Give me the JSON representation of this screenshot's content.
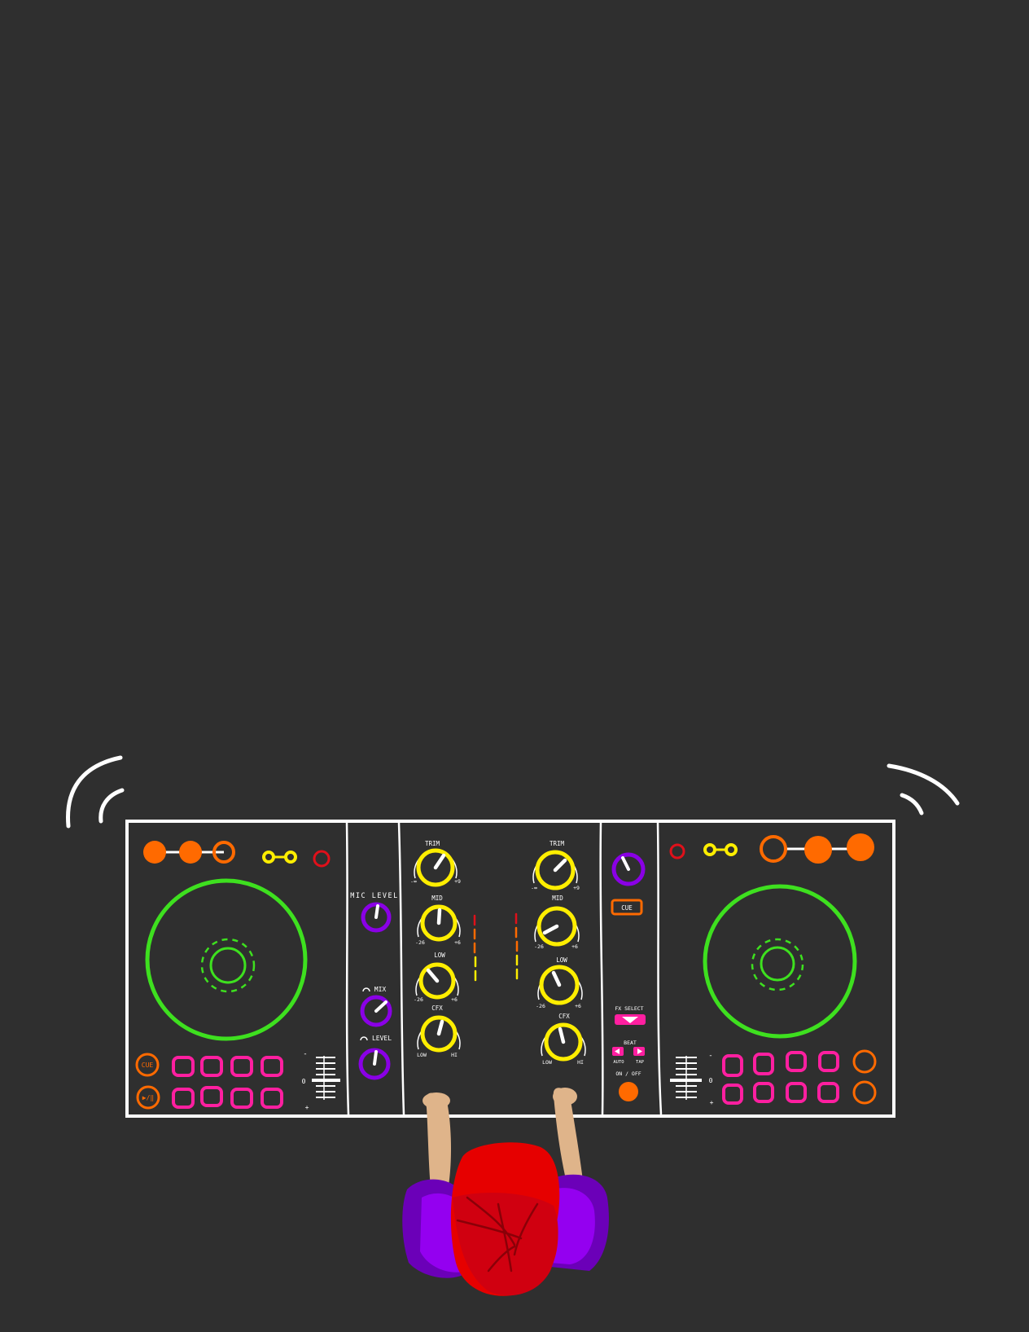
{
  "colors": {
    "background": "#2f2f2f",
    "outline": "#ffffff",
    "jog_wheel": "#3ee01f",
    "knob_eq": "#ffee00",
    "knob_purple": "#8a00e6",
    "pads": "#ff1fa0",
    "orange": "#ff6a00",
    "red": "#e0101a",
    "skin": "#dfb48a",
    "cap": "#e60000",
    "shirt": "#9400f0"
  },
  "mic_section": {
    "mic_level_label": "MIC LEVEL",
    "mix_label": "MIX",
    "level_label": "LEVEL"
  },
  "channel_1": {
    "trim_label": "TRIM",
    "trim_min": "-∞",
    "trim_max": "+9",
    "mid_label": "MID",
    "mid_min": "-26",
    "mid_max": "+6",
    "low_label": "LOW",
    "low_min": "-26",
    "low_max": "+6",
    "cfx_label": "CFX",
    "cfx_min": "LOW",
    "cfx_max": "HI"
  },
  "channel_2": {
    "trim_label": "TRIM",
    "trim_min": "-∞",
    "trim_max": "+9",
    "mid_label": "MID",
    "mid_min": "-26",
    "mid_max": "+6",
    "low_label": "LOW",
    "low_min": "-26",
    "low_max": "+6",
    "cfx_label": "CFX",
    "cfx_min": "LOW",
    "cfx_max": "HI"
  },
  "fx_section": {
    "cue_label": "CUE",
    "fx_select_label": "FX SELECT",
    "beat_label": "BEAT",
    "auto_label": "AUTO",
    "tap_label": "TAP",
    "on_off_label": "ON / OFF"
  },
  "deck_left": {
    "cue_label": "CUE",
    "play_label": "▶/‖",
    "tempo_minus": "-",
    "tempo_zero": "0",
    "tempo_plus": "+"
  },
  "deck_right": {
    "tempo_minus": "-",
    "tempo_zero": "0",
    "tempo_plus": "+"
  }
}
